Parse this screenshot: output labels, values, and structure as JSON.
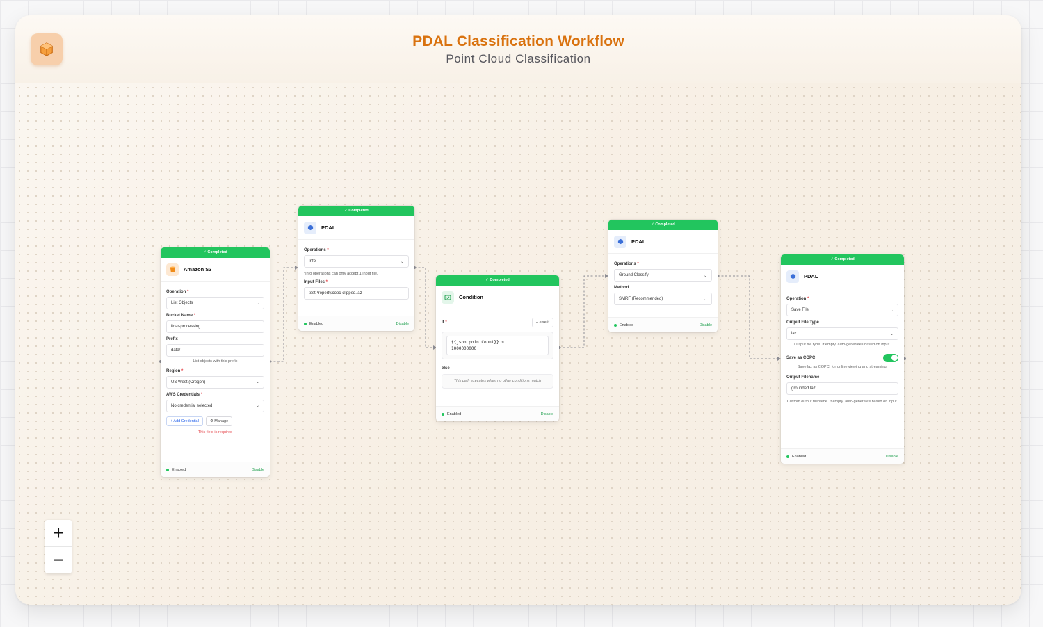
{
  "header": {
    "title": "PDAL Classification Workflow",
    "subtitle": "Point Cloud Classification"
  },
  "colors": {
    "accent": "#d9720f",
    "success": "#22c55e",
    "error": "#e5484d"
  },
  "common": {
    "status": "✓ Completed",
    "enabled": "Enabled",
    "disable": "Disable",
    "required": "*",
    "chevron": "⌄"
  },
  "nodes": {
    "s3": {
      "title": "Amazon S3",
      "icon": "s3-bucket-icon",
      "operation_label": "Operation",
      "operation_value": "List Objects",
      "bucket_label": "Bucket Name",
      "bucket_value": "lidar-processing",
      "prefix_label": "Prefix",
      "prefix_value": "data/",
      "prefix_hint": "List objects with this prefix",
      "region_label": "Region",
      "region_value": "US West (Oregon)",
      "cred_label": "AWS Credentials",
      "cred_value": "No credential selected",
      "add_credential": "+ Add Credential",
      "manage": "⚙ Manage",
      "error": "This field is required"
    },
    "pdal1": {
      "title": "PDAL",
      "operations_label": "Operations",
      "operations_value": "Info",
      "info_note": "*Info operations can only accept 1 input file.",
      "input_label": "Input Files",
      "input_value": "testProperty.copc-clipped.laz"
    },
    "condition": {
      "title": "Condition",
      "if_label": "if",
      "else_if": "+ else if",
      "expr_line1": "{{json.pointCount}} >",
      "expr_line2": "1000000000",
      "else_label": "else",
      "else_hint": "This path executes when no other conditions match"
    },
    "pdal2": {
      "title": "PDAL",
      "operations_label": "Operations",
      "operations_value": "Ground Classify",
      "method_label": "Method",
      "method_value": "SMRF (Recommended)"
    },
    "pdal3": {
      "title": "PDAL",
      "operation_label": "Operation",
      "operation_value": "Save File",
      "type_label": "Output File Type",
      "type_value": "laz",
      "type_hint": "Output file type. If empty, auto-generates based on input.",
      "copc_label": "Save as COPC",
      "copc_on": true,
      "copc_hint": "Save laz as COPC, for online viewing and streaming.",
      "filename_label": "Output Filename",
      "filename_value": "grounded.laz",
      "filename_hint": "Custom output filename. If empty, auto-generates based on input."
    }
  },
  "zoom": {
    "in": "+",
    "out": "−"
  }
}
